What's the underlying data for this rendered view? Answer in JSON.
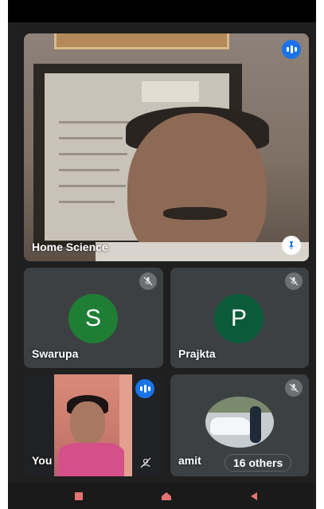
{
  "participants": {
    "main": {
      "name": "Home Science",
      "speaking_icon": "audio-level-icon",
      "pin_icon": "pin-icon"
    },
    "tile_s": {
      "name": "Swarupa",
      "initial": "S",
      "avatar_color": "#1e7e34",
      "mute_icon": "mic-off-icon"
    },
    "tile_p": {
      "name": "Prajkta",
      "initial": "P",
      "avatar_color": "#0b5a3a",
      "mute_icon": "mic-off-icon"
    },
    "self": {
      "name": "You",
      "speaking_icon": "audio-level-icon",
      "effects_icon": "effects-icon"
    },
    "others": {
      "name": "amit",
      "count_label": "16 others",
      "mute_icon": "mic-off-icon"
    }
  },
  "nav": {
    "recent_icon": "recent-apps-icon",
    "home_icon": "home-icon",
    "back_icon": "back-icon"
  },
  "colors": {
    "accent": "#1a73e8",
    "tile_bg": "#3c4043",
    "background": "#1f1f1f"
  }
}
